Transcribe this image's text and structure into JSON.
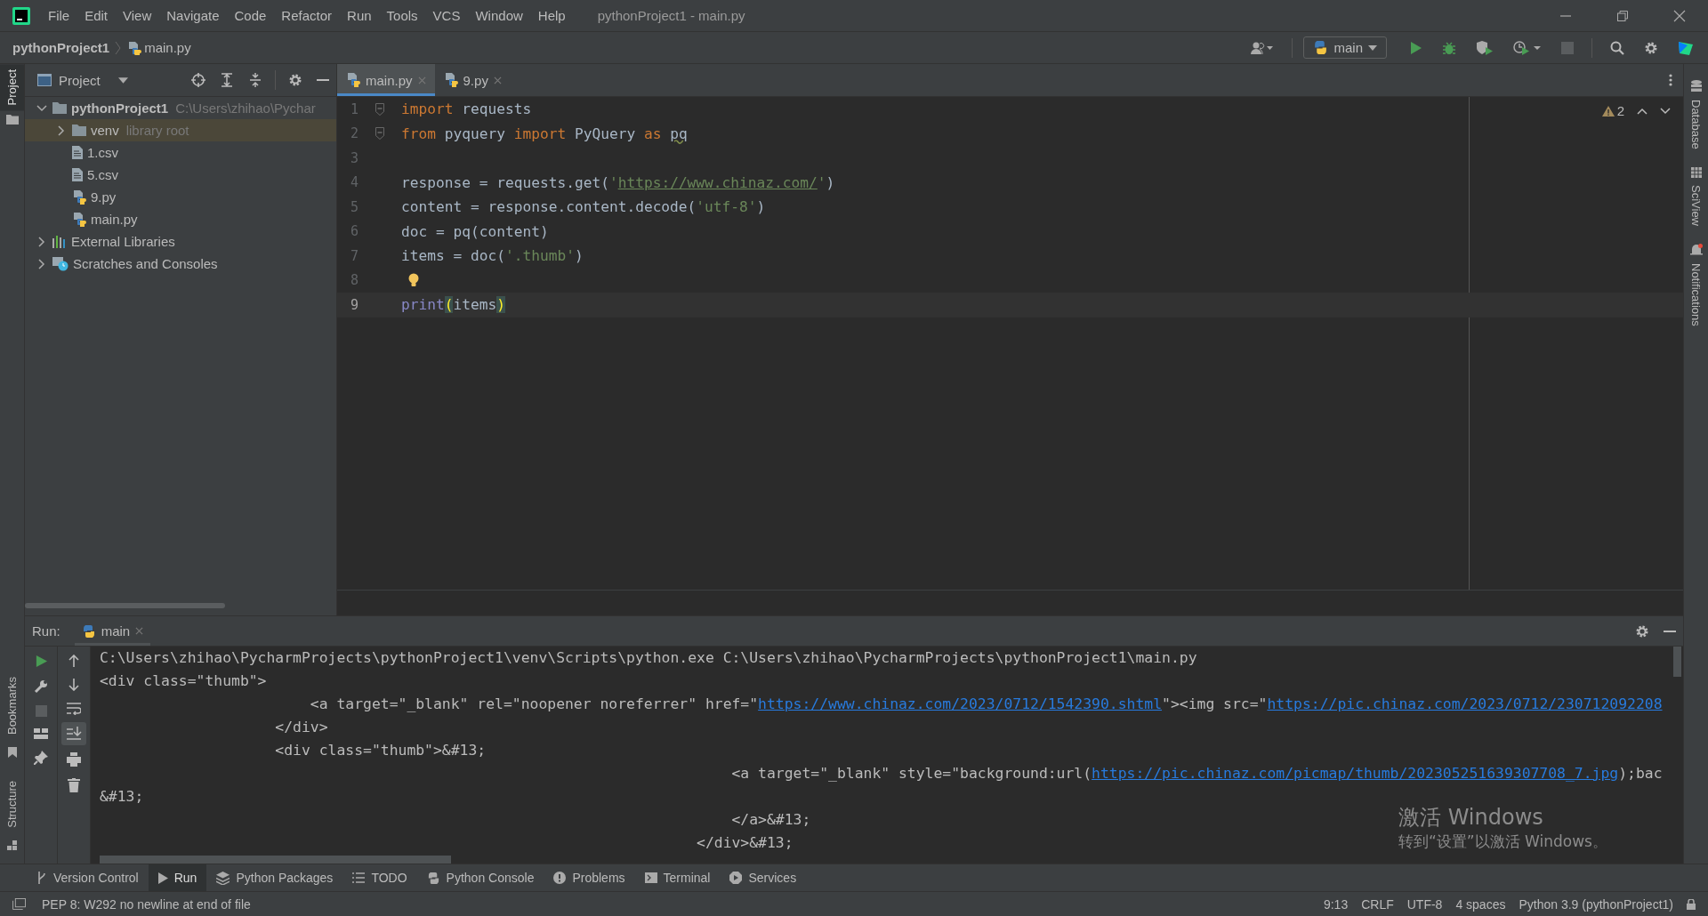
{
  "window": {
    "title": "pythonProject1 - main.py",
    "menu": [
      "File",
      "Edit",
      "View",
      "Navigate",
      "Code",
      "Refactor",
      "Run",
      "Tools",
      "VCS",
      "Window",
      "Help"
    ]
  },
  "navbar": {
    "crumbs": [
      {
        "label": "pythonProject1",
        "kind": "project"
      },
      {
        "label": "main.py",
        "kind": "python"
      }
    ],
    "run_config": "main"
  },
  "left_stripe": {
    "top": [
      {
        "label": "Project",
        "selected": true
      }
    ],
    "bottom": [
      {
        "label": "Bookmarks",
        "kind": "bookmark"
      },
      {
        "label": "Structure",
        "kind": "structure"
      }
    ]
  },
  "right_stripe": [
    {
      "label": "Database",
      "kind": "database"
    },
    {
      "label": "SciView",
      "kind": "sciview"
    },
    {
      "label": "Notifications",
      "kind": "bell"
    }
  ],
  "project": {
    "title": "Project",
    "tree": [
      {
        "label": "pythonProject1",
        "hint": "C:\\Users\\zhihao\\Pychar",
        "kind": "project",
        "expanded": true,
        "selected": false,
        "children": [
          {
            "label": "venv",
            "hint": "library root",
            "kind": "folder",
            "expanded": false,
            "selected": true
          },
          {
            "label": "1.csv",
            "kind": "csv",
            "selected": false
          },
          {
            "label": "5.csv",
            "kind": "csv",
            "selected": false
          },
          {
            "label": "9.py",
            "kind": "python",
            "selected": false
          },
          {
            "label": "main.py",
            "kind": "python",
            "selected": false
          }
        ]
      },
      {
        "label": "External Libraries",
        "kind": "libraries",
        "expanded": false,
        "selected": false
      },
      {
        "label": "Scratches and Consoles",
        "kind": "scratches",
        "expanded": false,
        "selected": false
      }
    ]
  },
  "editor": {
    "tabs": [
      {
        "label": "main.py",
        "selected": true
      },
      {
        "label": "9.py",
        "selected": false
      }
    ],
    "warnings": "2",
    "lines": [
      {
        "number": "1",
        "current": false,
        "kind": "fold",
        "tokens": [
          {
            "t": "import",
            "kind": "kw"
          },
          {
            "t": " requests",
            "kind": "id"
          }
        ]
      },
      {
        "number": "2",
        "current": false,
        "kind": "fold",
        "tokens": [
          {
            "t": "from",
            "kind": "kw"
          },
          {
            "t": " pyquery ",
            "kind": "id"
          },
          {
            "t": "import",
            "kind": "kw"
          },
          {
            "t": " PyQuery ",
            "kind": "id"
          },
          {
            "t": "as ",
            "kind": "kw"
          },
          {
            "t": "pq",
            "kind": "typo"
          }
        ]
      },
      {
        "number": "3",
        "current": false,
        "kind": "plain"
      },
      {
        "number": "4",
        "current": false,
        "kind": "plain",
        "tokens": [
          {
            "t": "response = requests.get(",
            "kind": "id"
          },
          {
            "t": "'",
            "kind": "str"
          },
          {
            "t": "https://www.chinaz.com/",
            "kind": "url"
          },
          {
            "t": "'",
            "kind": "str"
          },
          {
            "t": ")",
            "kind": "id"
          }
        ]
      },
      {
        "number": "5",
        "current": false,
        "kind": "plain",
        "tokens": [
          {
            "t": "content = response.content.decode(",
            "kind": "id"
          },
          {
            "t": "'utf-8'",
            "kind": "str"
          },
          {
            "t": ")",
            "kind": "id"
          }
        ]
      },
      {
        "number": "6",
        "current": false,
        "kind": "plain",
        "tokens": [
          {
            "t": "doc = pq(content)",
            "kind": "id"
          }
        ]
      },
      {
        "number": "7",
        "current": false,
        "kind": "plain",
        "tokens": [
          {
            "t": "items = doc(",
            "kind": "id"
          },
          {
            "t": "'.thumb'",
            "kind": "str"
          },
          {
            "t": ")",
            "kind": "id"
          }
        ]
      },
      {
        "number": "8",
        "current": false,
        "kind": "bulb"
      },
      {
        "number": "9",
        "current": true,
        "kind": "plain",
        "tokens": [
          {
            "t": "print",
            "kind": "builtin"
          },
          {
            "t": "(",
            "kind": "brace"
          },
          {
            "t": "items",
            "kind": "id"
          },
          {
            "t": ")",
            "kind": "brace"
          }
        ]
      }
    ]
  },
  "run": {
    "title": "Run:",
    "tab": "main",
    "output": [
      {
        "tokens": [
          {
            "t": "C:\\Users\\zhihao\\PycharmProjects\\pythonProject1\\venv\\Scripts\\python.exe C:\\Users\\zhihao\\PycharmProjects\\pythonProject1\\main.py",
            "kind": "text"
          }
        ]
      },
      {
        "tokens": [
          {
            "t": "<div class=\"thumb\">",
            "kind": "text"
          }
        ]
      },
      {
        "tokens": [
          {
            "t": "                        <a target=\"_blank\" rel=\"noopener noreferrer\" href=\"",
            "kind": "text"
          },
          {
            "t": "https://www.chinaz.com/2023/0712/1542390.shtml",
            "kind": "link"
          },
          {
            "t": "\"><img src=\"",
            "kind": "text"
          },
          {
            "t": "https://pic.chinaz.com/2023/0712/230712092208",
            "kind": "link"
          }
        ]
      },
      {
        "tokens": [
          {
            "t": "                    </div>",
            "kind": "text"
          }
        ]
      },
      {
        "tokens": [
          {
            "t": "                    <div class=\"thumb\">&#13;",
            "kind": "text"
          }
        ]
      },
      {
        "tokens": [
          {
            "t": "                                                                        <a target=\"_blank\" style=\"background:url(",
            "kind": "text"
          },
          {
            "t": "https://pic.chinaz.com/picmap/thumb/202305251639307708_7.jpg",
            "kind": "link"
          },
          {
            "t": ");bac",
            "kind": "text"
          }
        ]
      },
      {
        "tokens": [
          {
            "t": "&#13;",
            "kind": "text"
          }
        ]
      },
      {
        "tokens": [
          {
            "t": "                                                                        </a>&#13;",
            "kind": "text"
          }
        ]
      },
      {
        "tokens": [
          {
            "t": "                                                                    </div>&#13;",
            "kind": "text"
          }
        ]
      }
    ]
  },
  "tool_windows": [
    {
      "label": "Version Control",
      "kind": "vcs",
      "selected": false
    },
    {
      "label": "Run",
      "kind": "run",
      "selected": true
    },
    {
      "label": "Python Packages",
      "kind": "packages",
      "selected": false
    },
    {
      "label": "TODO",
      "kind": "todo",
      "selected": false
    },
    {
      "label": "Python Console",
      "kind": "console",
      "selected": false
    },
    {
      "label": "Problems",
      "kind": "problems",
      "selected": false
    },
    {
      "label": "Terminal",
      "kind": "terminal",
      "selected": false
    },
    {
      "label": "Services",
      "kind": "services",
      "selected": false
    }
  ],
  "status_bar": {
    "message": "PEP 8: W292 no newline at end of file",
    "items": [
      "9:13",
      "CRLF",
      "UTF-8",
      "4 spaces",
      "Python 3.9 (pythonProject1)"
    ]
  },
  "os_overlay": {
    "title": "激活 Windows",
    "subtitle": "转到“设置”以激活 Windows。"
  }
}
